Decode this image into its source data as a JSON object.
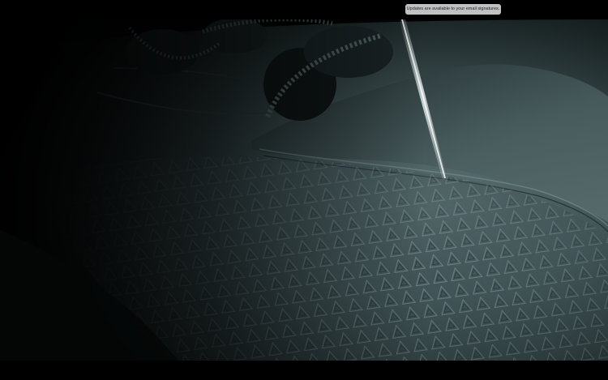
{
  "notification": {
    "text": "Updates are available to your email signatures."
  },
  "colors": {
    "letterbox": "#000000",
    "shoe_highlight": "#5d7274",
    "shoe_mid": "#334446",
    "shoe_shadow": "#0d1213",
    "notification_bg": "#bfc1c2"
  }
}
